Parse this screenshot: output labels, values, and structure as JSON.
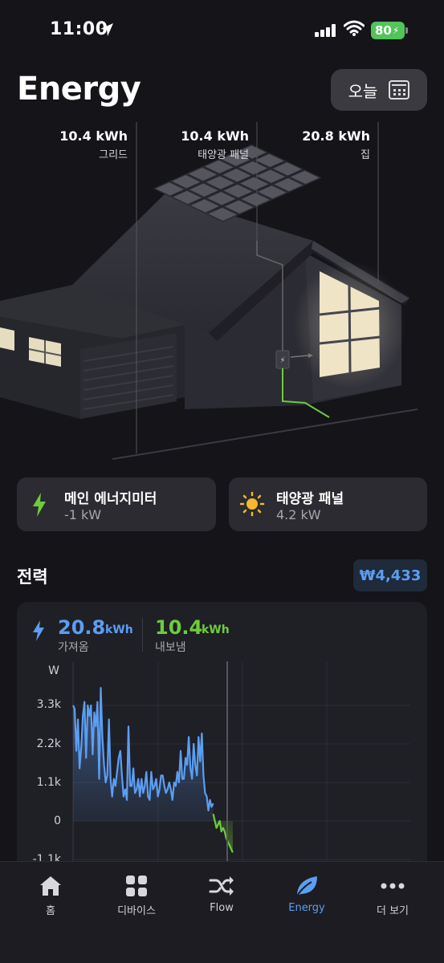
{
  "status_bar": {
    "time": "11:00",
    "battery": "80"
  },
  "header": {
    "title": "Energy",
    "date_button": "오늘"
  },
  "scene_labels": [
    {
      "value": "10.4 kWh",
      "name": "그리드"
    },
    {
      "value": "10.4 kWh",
      "name": "태양광 패널"
    },
    {
      "value": "20.8 kWh",
      "name": "집"
    }
  ],
  "devices": [
    {
      "name": "메인 에너지미터",
      "value": "-1 kW",
      "icon": "bolt-icon"
    },
    {
      "name": "태양광 패널",
      "value": "4.2 kW",
      "icon": "sun-icon"
    }
  ],
  "power": {
    "title": "전력",
    "cost": "₩4,433",
    "import_value": "20.8",
    "import_unit": "kWh",
    "import_label": "가져옴",
    "export_value": "10.4",
    "export_unit": "kWh",
    "export_label": "내보냄"
  },
  "chart_data": {
    "type": "area",
    "ylabel": "W",
    "y_ticks": [
      "3.3k",
      "2.2k",
      "1.1k",
      "0",
      "-1.1k"
    ],
    "ylim": [
      -1100,
      4400
    ],
    "colors": {
      "import": "#5b9ef2",
      "export": "#6ecc3a"
    },
    "series": [
      {
        "values": [
          3300,
          3200,
          2000,
          2900,
          1500,
          2100,
          3000,
          3400,
          1800,
          3300,
          3000,
          3300,
          1900,
          3100,
          2700,
          3400,
          1200,
          3800,
          2400,
          1600,
          1100,
          1300,
          2900,
          1200,
          700,
          1200,
          1000,
          1400,
          1800,
          2000,
          1300,
          700,
          900,
          600,
          2700,
          1000,
          1000,
          1500,
          800,
          900,
          1200,
          700,
          1200,
          800,
          1000,
          1400,
          700,
          600,
          1400,
          900,
          1000,
          1200,
          700,
          900,
          1300,
          1300,
          1000,
          800,
          900,
          1100,
          900,
          600,
          1100,
          1000,
          1400,
          1100,
          2000,
          1200,
          1200,
          1800,
          1600,
          2400,
          1500,
          1200,
          2200,
          1600,
          1300,
          2400,
          1700,
          2500,
          1300,
          800,
          700,
          300,
          600,
          400,
          500
        ]
      },
      {
        "values": [
          200,
          0,
          -200,
          -100,
          0,
          -300,
          -200,
          -300,
          -500,
          -600,
          -700,
          -800,
          -900
        ]
      }
    ],
    "cursor_label": ""
  },
  "tabs": [
    {
      "label": "홈",
      "icon": "home-icon"
    },
    {
      "label": "디바이스",
      "icon": "devices-icon"
    },
    {
      "label": "Flow",
      "icon": "shuffle-icon"
    },
    {
      "label": "Energy",
      "icon": "leaf-icon"
    },
    {
      "label": "더 보기",
      "icon": "more-icon"
    }
  ]
}
